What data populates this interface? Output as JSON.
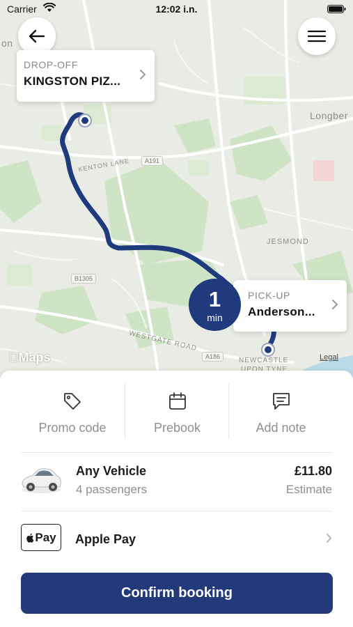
{
  "status_bar": {
    "carrier": "Carrier",
    "time": "12:02 i.n."
  },
  "map": {
    "place_labels": [
      "on",
      "Longber",
      "JESMOND",
      "KENTON LANE",
      "WESTGATE ROAD",
      "NEWCASTLE",
      "UPON TYNE"
    ],
    "road_numbers": [
      "A191",
      "B1305",
      "A186"
    ],
    "attribution": "Maps",
    "legal": "Legal",
    "route_color": "#1f3a7d"
  },
  "dropoff": {
    "caption": "DROP-OFF",
    "name": "KINGSTON PIZ..."
  },
  "pickup": {
    "caption": "PICK-UP",
    "name": "Anderson...",
    "eta_value": "1",
    "eta_unit": "min"
  },
  "actions": [
    {
      "label": "Promo code",
      "icon": "tag-icon"
    },
    {
      "label": "Prebook",
      "icon": "calendar-icon"
    },
    {
      "label": "Add note",
      "icon": "note-icon"
    }
  ],
  "vehicle": {
    "name": "Any Vehicle",
    "passengers": "4 passengers",
    "price": "£11.80",
    "price_note": "Estimate"
  },
  "payment": {
    "badge": "Pay",
    "label": "Apple Pay"
  },
  "confirm": {
    "label": "Confirm booking"
  },
  "colors": {
    "primary": "#223a7a",
    "muted_text": "#8e8e93"
  }
}
